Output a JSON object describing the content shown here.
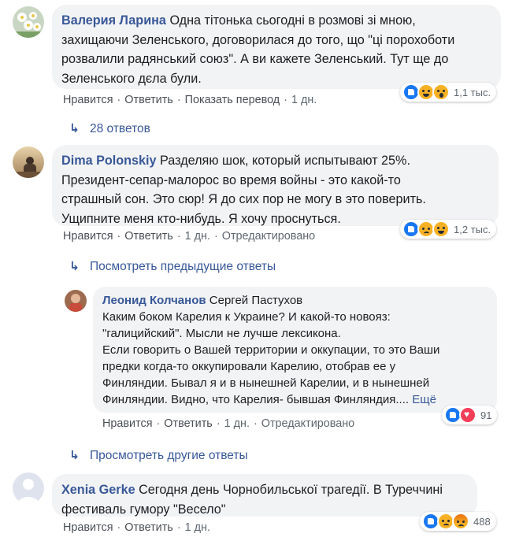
{
  "comments": [
    {
      "author": "Валерия Ларина",
      "text_lines": [
        "Одна тітонька сьогодні в розмові зі мною,",
        "захищаючи Зеленського, договорилася до того, що \"ці порохоботи",
        "розвалили радянський союз\". А ви кажете Зеленський. Тут ще до",
        "Зеленського дєла були."
      ],
      "actions": {
        "like": "Нравится",
        "reply": "Ответить",
        "translate": "Показать перевод",
        "time": "1 дн."
      },
      "reactions": {
        "icons": [
          "like-icon",
          "haha-icon",
          "wow-icon"
        ],
        "count": "1,1 тыс."
      },
      "replies_label": "28 ответов"
    },
    {
      "author": "Dima Polonskiy",
      "text_lines": [
        "Разделяю шок, который испытывают 25%.",
        "Президент-сепар-малорос во время войны - это какой-то",
        "страшный сон. Это сюр! Я до сих пор не могу в это поверить.",
        "Ущипните меня кто-нибудь. Я хочу проснуться."
      ],
      "actions": {
        "like": "Нравится",
        "reply": "Ответить",
        "time": "1 дн.",
        "edited": "Отредактировано"
      },
      "reactions": {
        "icons": [
          "like-icon",
          "sad-icon",
          "haha-icon"
        ],
        "count": "1,2 тыс."
      },
      "previous_label": "Посмотреть предыдущие ответы"
    },
    {
      "author": "Леонид Колчанов",
      "tag": "Сергей Пастухов",
      "text_lines": [
        "Каким боком Карелия к Украине? И какой-то новояз:",
        "\"галицийский\". Мысли не лучше лексикона.",
        "Если говорить о Вашей территории и оккупации, то это Ваши",
        "предки когда-то оккупировали Карелию, отобрав ее у",
        "Финляндии. Бывал я и в нынешней Карелии, и в нынешней",
        "Финляндии. Видно, что Карелия- бывшая Финляндия...."
      ],
      "more_label": "Ещё",
      "actions": {
        "like": "Нравится",
        "reply": "Ответить",
        "time": "1 дн.",
        "edited": "Отредактировано"
      },
      "reactions": {
        "icons": [
          "like-icon",
          "love-icon"
        ],
        "count": "91"
      },
      "other_label": "Просмотреть другие ответы"
    },
    {
      "author": "Xenia Gerke",
      "text_lines": [
        "Сегодня день Чорнобильської трагедії. В Туреччині",
        "фестиваль гумору \"Весело\""
      ],
      "actions": {
        "like": "Нравится",
        "reply": "Ответить",
        "time": "1 дн."
      },
      "reactions": {
        "icons": [
          "like-icon",
          "sad-icon",
          "angry-icon"
        ],
        "count": "488"
      }
    }
  ],
  "colors": {
    "link": "#385898",
    "bubble": "#f2f3f5",
    "meta": "#606770"
  }
}
